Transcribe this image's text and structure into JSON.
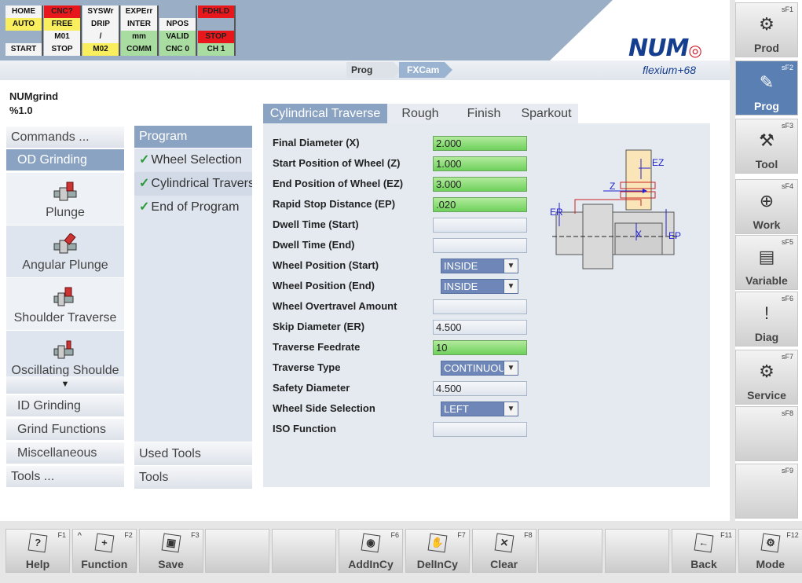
{
  "status": [
    {
      "label": "HOME",
      "color": "white"
    },
    {
      "label": "CNC?",
      "color": "red"
    },
    {
      "label": "SYSWr",
      "color": "white"
    },
    {
      "label": "EXPErr",
      "color": "white"
    },
    {
      "label": "",
      "color": "plain"
    },
    {
      "label": "FDHLD",
      "color": "red"
    },
    {
      "label": "AUTO",
      "color": "yellow"
    },
    {
      "label": "FREE",
      "color": "yellow"
    },
    {
      "label": "DRIP",
      "color": "white"
    },
    {
      "label": "INTER",
      "color": "white"
    },
    {
      "label": "NPOS",
      "color": "white"
    },
    {
      "label": "",
      "color": "plain"
    },
    {
      "label": "",
      "color": "plain"
    },
    {
      "label": "M01",
      "color": "white"
    },
    {
      "label": "/",
      "color": "white"
    },
    {
      "label": "mm",
      "color": "green"
    },
    {
      "label": "VALID",
      "color": "green"
    },
    {
      "label": "STOP",
      "color": "red"
    },
    {
      "label": "START",
      "color": "white"
    },
    {
      "label": "STOP",
      "color": "white"
    },
    {
      "label": "M02",
      "color": "yellow"
    },
    {
      "label": "COMM",
      "color": "green"
    },
    {
      "label": "CNC 0",
      "color": "green"
    },
    {
      "label": "CH 1",
      "color": "green"
    }
  ],
  "brand": {
    "logo": "NUM",
    "product": "flexium+68"
  },
  "breadcrumb": {
    "prog": "Prog",
    "fxcam": "FXCam"
  },
  "header": {
    "program_name": "NUMgrind",
    "program_id": "%1.0"
  },
  "left_menu": {
    "commands": "Commands ...",
    "od_grinding": "OD Grinding",
    "cycles": [
      "Plunge",
      "Angular Plunge",
      "Shoulder Traverse",
      "Oscillating Shoulde"
    ],
    "id_grinding": "ID Grinding",
    "grind_functions": "Grind Functions",
    "misc": "Miscellaneous",
    "tools": "Tools ..."
  },
  "program_col": {
    "title": "Program",
    "items": [
      "Wheel Selection",
      "Cylindrical Travers",
      "End of Program"
    ],
    "used_tools": "Used Tools",
    "tools": "Tools"
  },
  "tabs": [
    "Cylindrical Traverse",
    "Rough",
    "Finish",
    "Sparkout"
  ],
  "form": [
    {
      "label": "Final Diameter (X)",
      "value": "2.000",
      "type": "green"
    },
    {
      "label": "Start Position of Wheel (Z)",
      "value": "1.000",
      "type": "green"
    },
    {
      "label": "End Position of Wheel (EZ)",
      "value": "3.000",
      "type": "green"
    },
    {
      "label": "Rapid Stop Distance (EP)",
      "value": ".020",
      "type": "green"
    },
    {
      "label": "Dwell Time (Start)",
      "value": "",
      "type": "input"
    },
    {
      "label": "Dwell Time (End)",
      "value": "",
      "type": "input"
    },
    {
      "label": "Wheel Position (Start)",
      "value": "INSIDE",
      "type": "select"
    },
    {
      "label": "Wheel Position (End)",
      "value": "INSIDE",
      "type": "select"
    },
    {
      "label": "Wheel Overtravel Amount",
      "value": "",
      "type": "input"
    },
    {
      "label": "Skip Diameter (ER)",
      "value": "4.500",
      "type": "input"
    },
    {
      "label": "Traverse Feedrate",
      "value": "10",
      "type": "green"
    },
    {
      "label": "Traverse Type",
      "value": "CONTINUOUS",
      "type": "select"
    },
    {
      "label": "Safety Diameter",
      "value": "4.500",
      "type": "input"
    },
    {
      "label": "Wheel Side Selection",
      "value": "LEFT",
      "type": "select"
    },
    {
      "label": "ISO Function",
      "value": "",
      "type": "input"
    }
  ],
  "diagram": {
    "ez": "EZ",
    "z": "Z",
    "er": "ER",
    "x": "X",
    "ep": "EP"
  },
  "right_keys": [
    {
      "sf": "sF1",
      "label": "Prod",
      "icon": "gears-icon",
      "glyph": "⚙"
    },
    {
      "sf": "sF2",
      "label": "Prog",
      "icon": "pencil-hand-icon",
      "glyph": "✎"
    },
    {
      "sf": "sF3",
      "label": "Tool",
      "icon": "tool-icon",
      "glyph": "⚒"
    },
    {
      "sf": "sF4",
      "label": "Work",
      "icon": "work-icon",
      "glyph": "⊕"
    },
    {
      "sf": "sF5",
      "label": "Variable",
      "icon": "document-icon",
      "glyph": "▤"
    },
    {
      "sf": "sF6",
      "label": "Diag",
      "icon": "warning-icon",
      "glyph": "!"
    },
    {
      "sf": "sF7",
      "label": "Service",
      "icon": "service-icon",
      "glyph": "⚙"
    },
    {
      "sf": "sF8",
      "label": "",
      "icon": "",
      "glyph": ""
    },
    {
      "sf": "sF9",
      "label": "",
      "icon": "",
      "glyph": ""
    }
  ],
  "fkeys": [
    {
      "fn": "F1",
      "label": "Help",
      "icon": "help-icon",
      "glyph": "?"
    },
    {
      "fn": "F2",
      "label": "Function",
      "icon": "function-icon",
      "glyph": "+"
    },
    {
      "fn": "F3",
      "label": "Save",
      "icon": "save-icon",
      "glyph": "▣"
    },
    {
      "fn": "",
      "label": "",
      "icon": "",
      "glyph": ""
    },
    {
      "fn": "",
      "label": "",
      "icon": "",
      "glyph": ""
    },
    {
      "fn": "F6",
      "label": "AddInCy",
      "icon": "add-in-cycle-icon",
      "glyph": "◉"
    },
    {
      "fn": "F7",
      "label": "DelInCy",
      "icon": "delete-in-cycle-icon",
      "glyph": "✋"
    },
    {
      "fn": "F8",
      "label": "Clear",
      "icon": "clear-icon",
      "glyph": "✕"
    },
    {
      "fn": "",
      "label": "",
      "icon": "",
      "glyph": ""
    },
    {
      "fn": "",
      "label": "",
      "icon": "",
      "glyph": ""
    },
    {
      "fn": "F11",
      "label": "Back",
      "icon": "back-icon",
      "glyph": "←"
    },
    {
      "fn": "F12",
      "label": "Mode",
      "icon": "mode-icon",
      "glyph": "⚙"
    }
  ],
  "colors": {
    "accent": "#8ba3c2",
    "selected_key": "#5a7fb3",
    "green_field": "#6fd15c",
    "alarm_red": "#e8171b"
  }
}
